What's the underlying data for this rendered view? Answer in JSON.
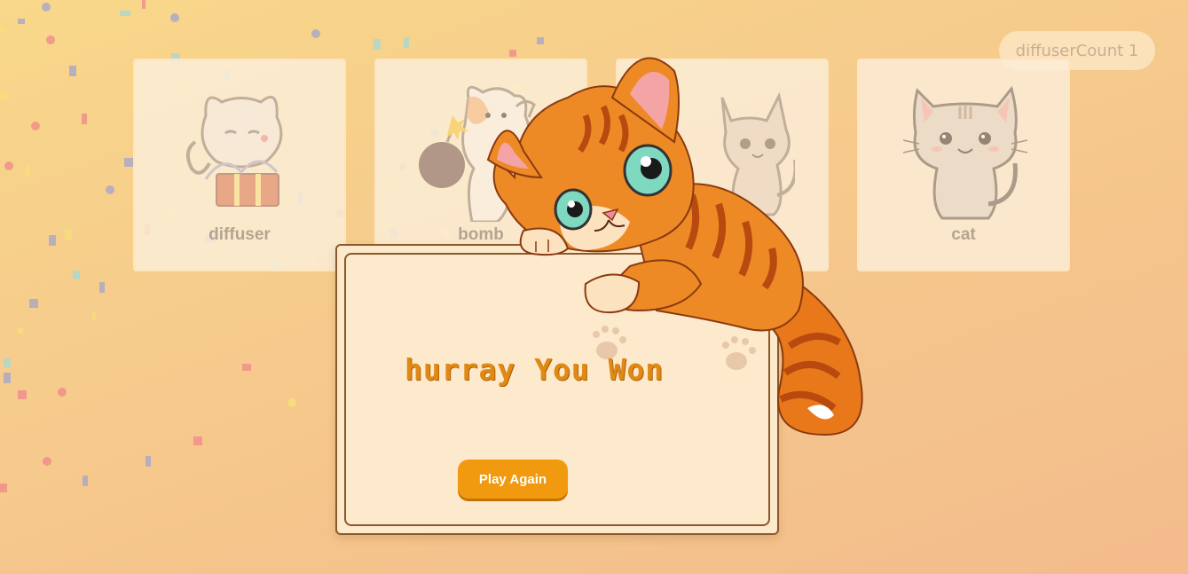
{
  "status": {
    "diffuser_count_label": "diffuserCount 1"
  },
  "cards": [
    {
      "label": "diffuser",
      "icon": "cat-with-gift-icon"
    },
    {
      "label": "bomb",
      "icon": "cat-with-bomb-icon"
    },
    {
      "label": "",
      "icon": "sitting-cat-icon"
    },
    {
      "label": "cat",
      "icon": "sitting-cat-icon"
    }
  ],
  "modal": {
    "message": "hurray You Won",
    "button_label": "Play Again"
  },
  "colors": {
    "accent": "#f19a10",
    "message": "#e08a15",
    "border": "#8a5a2c"
  }
}
